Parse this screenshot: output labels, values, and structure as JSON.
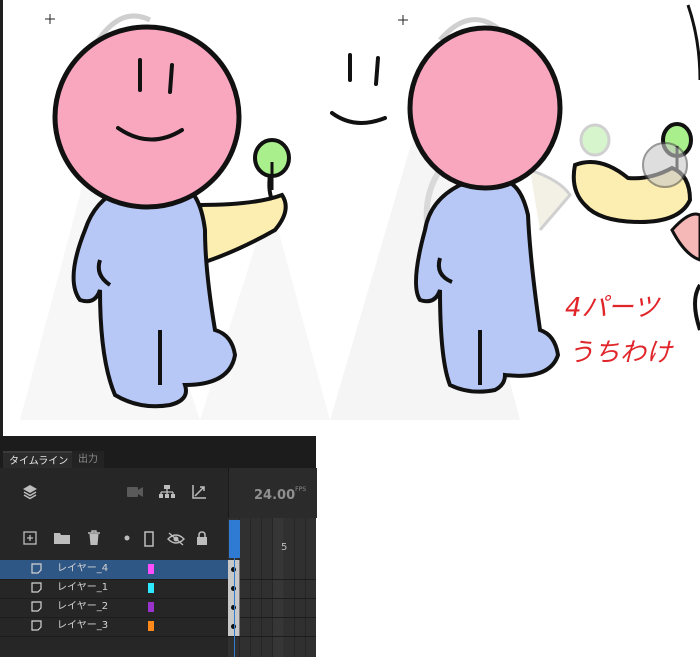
{
  "timeline": {
    "tabs": [
      {
        "label": "タイムライン",
        "active": true
      },
      {
        "label": "出力",
        "active": false
      }
    ],
    "fps": {
      "value": "24.00",
      "unit": "FPS"
    },
    "frame_marker": "5",
    "layers": [
      {
        "name": "レイヤー_4",
        "color": "#ff4dff",
        "selected": true
      },
      {
        "name": "レイヤー_1",
        "color": "#2ee8ff",
        "selected": false
      },
      {
        "name": "レイヤー_2",
        "color": "#9a33cc",
        "selected": false
      },
      {
        "name": "レイヤー_3",
        "color": "#ff8a1a",
        "selected": false
      }
    ],
    "icons": {
      "top": [
        "layers-icon",
        "camera-icon",
        "hierarchy-icon",
        "graph-icon"
      ],
      "layer_tools": [
        "add-layer-icon",
        "folder-icon",
        "trash-icon",
        "dot-icon",
        "outline-icon",
        "hide-icon",
        "lock-icon"
      ]
    }
  },
  "canvas": {
    "annotation_lines": [
      "4パーツ",
      "うちわけ"
    ],
    "colors": {
      "head": "#f9a6bf",
      "body": "#b7c8f6",
      "arm": "#fcedb0",
      "sprout": "#a9ef8b",
      "annotation": "#e0262b"
    }
  }
}
